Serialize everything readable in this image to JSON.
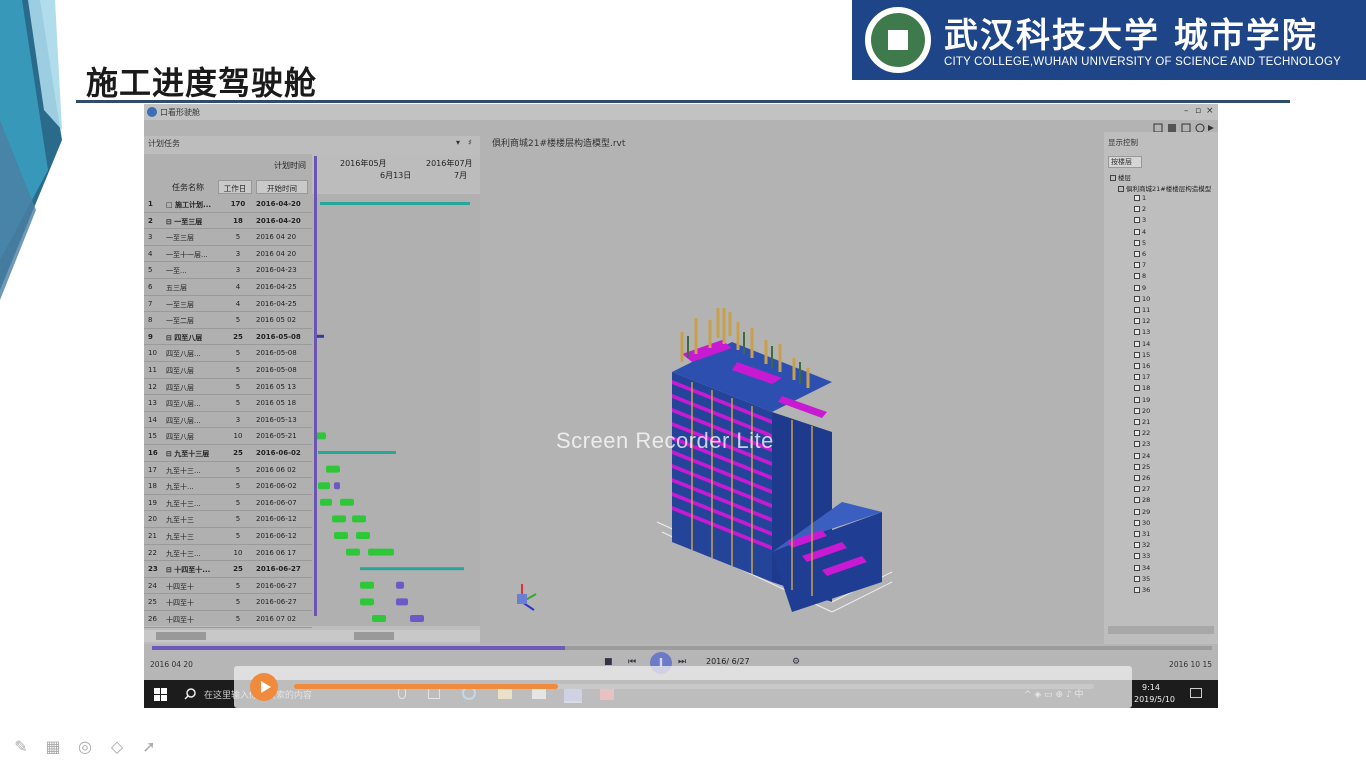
{
  "slide": {
    "title": "施工进度驾驶舱",
    "logo": {
      "name_cn": "武汉科技大学 城市学院",
      "name_en": "CITY COLLEGE,WUHAN UNIVERSITY OF SCIENCE AND TECHNOLOGY"
    }
  },
  "app": {
    "window_title": "口看形驶舱",
    "left_panel": {
      "title": "计划任务",
      "headers": {
        "plan_time": "计划时间",
        "name": "任务名称",
        "duration": "工作日",
        "start": "开始时间",
        "month1": "2016年05月",
        "month2": "2016年07月",
        "week": "6月13日",
        "month3": "7月"
      },
      "rows": [
        {
          "no": "1",
          "name": "□ 施工计划...",
          "dur": "170",
          "start": "2016-04-20",
          "bold": true
        },
        {
          "no": "2",
          "name": "⊟ 一至三层",
          "dur": "18",
          "start": "2016-04-20",
          "bold": true
        },
        {
          "no": "3",
          "name": "一至三层",
          "dur": "5",
          "start": "2016 04 20",
          "bold": false
        },
        {
          "no": "4",
          "name": "一至十一层...",
          "dur": "3",
          "start": "2016 04 20",
          "bold": false
        },
        {
          "no": "5",
          "name": "一至...",
          "dur": "3",
          "start": "2016-04-23",
          "bold": false
        },
        {
          "no": "6",
          "name": "五三层",
          "dur": "4",
          "start": "2016-04-25",
          "bold": false
        },
        {
          "no": "7",
          "name": "一至三层",
          "dur": "4",
          "start": "2016-04-25",
          "bold": false
        },
        {
          "no": "8",
          "name": "一至二层",
          "dur": "5",
          "start": "2016 05 02",
          "bold": false
        },
        {
          "no": "9",
          "name": "⊟ 四至八层",
          "dur": "25",
          "start": "2016-05-08",
          "bold": true
        },
        {
          "no": "10",
          "name": "四至八层...",
          "dur": "5",
          "start": "2016-05-08",
          "bold": false
        },
        {
          "no": "11",
          "name": "四至八层",
          "dur": "5",
          "start": "2016-05-08",
          "bold": false
        },
        {
          "no": "12",
          "name": "四至八层",
          "dur": "5",
          "start": "2016 05 13",
          "bold": false
        },
        {
          "no": "13",
          "name": "四至八层...",
          "dur": "5",
          "start": "2016 05 18",
          "bold": false
        },
        {
          "no": "14",
          "name": "四至八层...",
          "dur": "3",
          "start": "2016-05-13",
          "bold": false
        },
        {
          "no": "15",
          "name": "四至八层",
          "dur": "10",
          "start": "2016-05-21",
          "bold": false
        },
        {
          "no": "16",
          "name": "⊟ 九至十三层",
          "dur": "25",
          "start": "2016-06-02",
          "bold": true
        },
        {
          "no": "17",
          "name": "九至十三...",
          "dur": "5",
          "start": "2016 06 02",
          "bold": false
        },
        {
          "no": "18",
          "name": "九至十...",
          "dur": "5",
          "start": "2016-06-02",
          "bold": false
        },
        {
          "no": "19",
          "name": "九至十三...",
          "dur": "5",
          "start": "2016-06-07",
          "bold": false
        },
        {
          "no": "20",
          "name": "九至十三",
          "dur": "5",
          "start": "2016-06-12",
          "bold": false
        },
        {
          "no": "21",
          "name": "九至十三",
          "dur": "5",
          "start": "2016-06-12",
          "bold": false
        },
        {
          "no": "22",
          "name": "九至十三...",
          "dur": "10",
          "start": "2016 06 17",
          "bold": false
        },
        {
          "no": "23",
          "name": "⊟ 十四至十...",
          "dur": "25",
          "start": "2016-06-27",
          "bold": true
        },
        {
          "no": "24",
          "name": "十四至十",
          "dur": "5",
          "start": "2016-06-27",
          "bold": false
        },
        {
          "no": "25",
          "name": "十四至十",
          "dur": "5",
          "start": "2016-06-27",
          "bold": false
        },
        {
          "no": "26",
          "name": "十四至十",
          "dur": "5",
          "start": "2016 07 02",
          "bold": false
        }
      ]
    },
    "viewport": {
      "title": "俱利商城21#楼楼层构造模型.rvt",
      "watermark": "Screen Recorder Lite"
    },
    "right_panel": {
      "title": "显示控制",
      "dropdown": "按楼层",
      "root": "楼层",
      "model": "俱利商城21#楼楼层构造模型",
      "floors": [
        "1",
        "2",
        "3",
        "4",
        "5",
        "6",
        "7",
        "8",
        "9",
        "10",
        "11",
        "12",
        "13",
        "14",
        "15",
        "16",
        "17",
        "18",
        "19",
        "20",
        "21",
        "22",
        "23",
        "24",
        "25",
        "26",
        "27",
        "28",
        "29",
        "30",
        "31",
        "32",
        "33",
        "34",
        "35",
        "36"
      ]
    },
    "playback": {
      "start_date": "2016 04 20",
      "end_date": "2016 10 15",
      "current_date": "2016/ 6/27",
      "progress": 0.39
    },
    "taskbar": {
      "search_text": "在这里输入你要搜索的内容",
      "time": "9:14",
      "date": "2019/5/10"
    }
  },
  "recorder": {
    "progress": 0.33
  },
  "colors": {
    "title_rule": "#2d4d6b",
    "logo_bg": "#1d4588",
    "gantt_green": "#2fc73a",
    "gantt_blue": "#2c3f9a",
    "gantt_teal": "#26a79a",
    "today_line": "#6b55b0",
    "building_blue": "#1e3a8c",
    "building_magenta": "#c81ad2"
  }
}
